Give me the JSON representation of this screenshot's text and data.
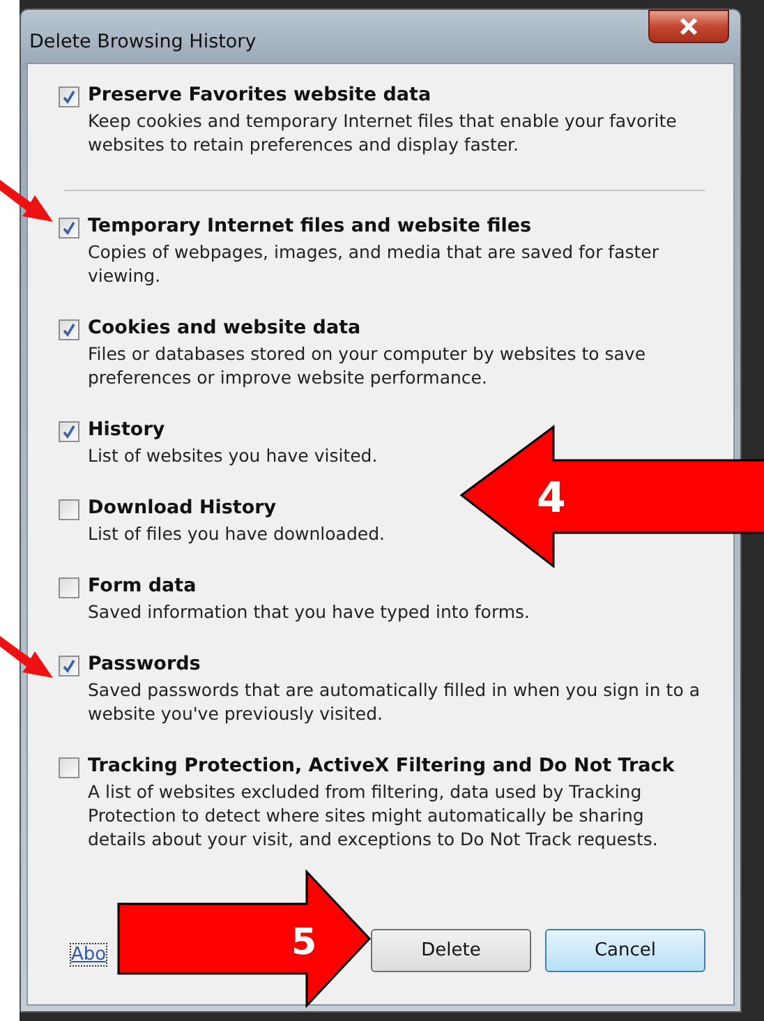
{
  "window": {
    "title": "Delete Browsing History"
  },
  "preserve": {
    "label": "Preserve Favorites website data",
    "checked": true,
    "description": "Keep cookies and temporary Internet files that enable your favorite websites to retain preferences and display faster."
  },
  "options": [
    {
      "label": "Temporary Internet files and website files",
      "checked": true,
      "description": "Copies of webpages, images, and media that are saved for faster viewing."
    },
    {
      "label": "Cookies and website data",
      "checked": true,
      "description": "Files or databases stored on your computer by websites to save preferences or improve website performance."
    },
    {
      "label": "History",
      "checked": true,
      "description": "List of websites you have visited."
    },
    {
      "label": "Download History",
      "checked": false,
      "description": "List of files you have downloaded."
    },
    {
      "label": "Form data",
      "checked": false,
      "description": "Saved information that you have typed into forms."
    },
    {
      "label": "Passwords",
      "checked": true,
      "description": "Saved passwords that are automatically filled in when you sign in to a website you've previously visited."
    },
    {
      "label": "Tracking Protection, ActiveX Filtering and Do Not Track",
      "checked": false,
      "description": "A list of websites excluded from filtering, data used by Tracking Protection to detect where sites might automatically be sharing details about your visit, and exceptions to Do Not Track requests."
    }
  ],
  "footer": {
    "link": "Abo",
    "buttons": [
      {
        "label": "Delete",
        "selected": false
      },
      {
        "label": "Cancel",
        "selected": true
      }
    ]
  },
  "annotations": [
    {
      "label": "4"
    },
    {
      "label": "5"
    }
  ]
}
